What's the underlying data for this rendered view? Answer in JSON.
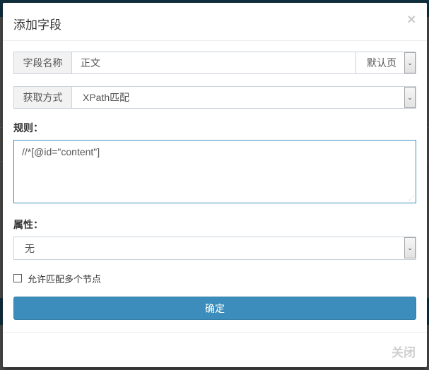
{
  "modal": {
    "title": "添加字段",
    "close_icon": "×",
    "field_name": {
      "label": "字段名称",
      "value": "正文",
      "page_select": "默认页"
    },
    "fetch_method": {
      "label": "获取方式",
      "selected": "XPath匹配"
    },
    "rule": {
      "label": "规则：",
      "value": "//*[@id=\"content\"]"
    },
    "attribute": {
      "label": "属性：",
      "selected": "无"
    },
    "allow_multiple": {
      "label": "允许匹配多个节点",
      "checked": false
    },
    "confirm_button": "确定",
    "close_button": "关闭"
  },
  "icons": {
    "select_arrow": "⌄",
    "resize_grip": "⋰"
  },
  "colors": {
    "primary": "#3c8dbc",
    "overlay": "#4b4b4b",
    "header_band": "#11303f"
  }
}
